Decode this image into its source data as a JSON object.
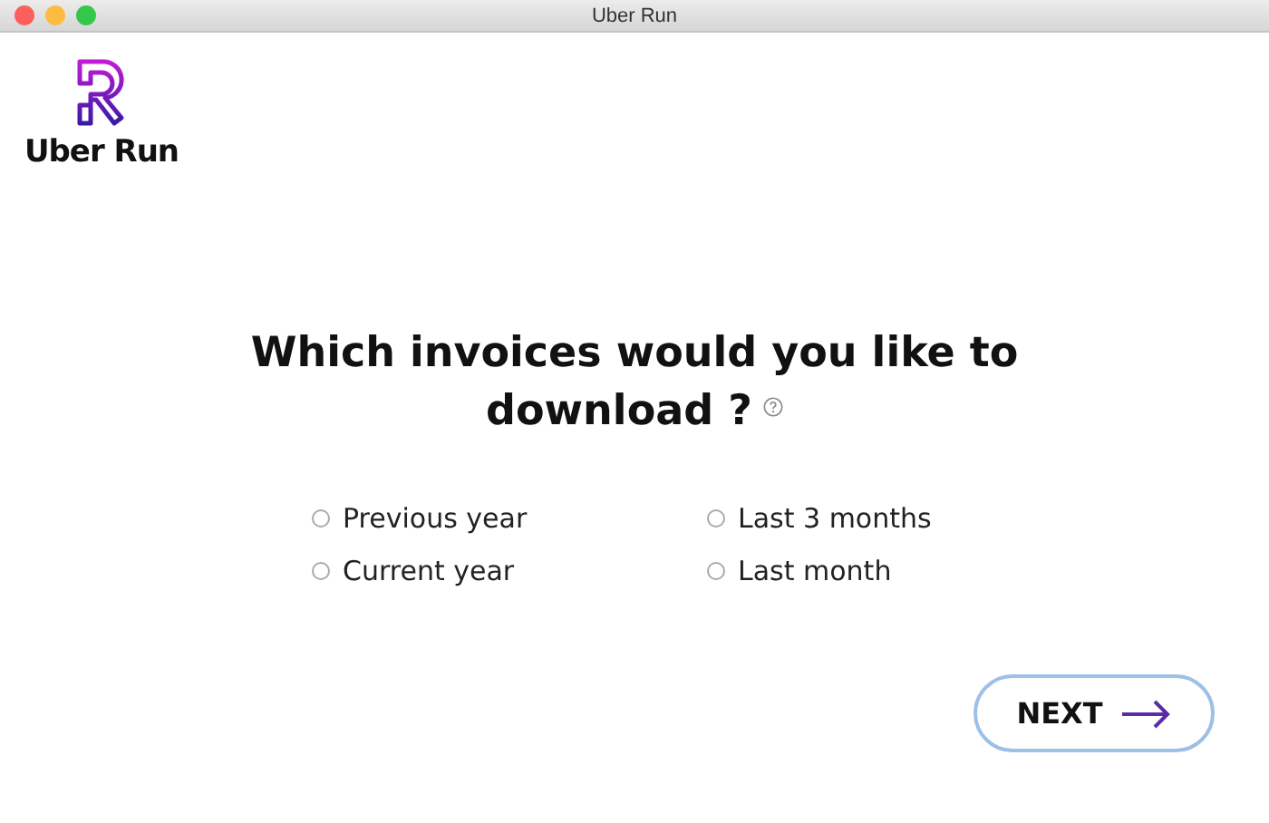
{
  "window": {
    "title": "Uber Run"
  },
  "app": {
    "name": "Uber Run"
  },
  "question": "Which invoices would you like to download ?",
  "options": [
    {
      "label": "Previous year",
      "selected": false
    },
    {
      "label": "Last 3 months",
      "selected": false
    },
    {
      "label": "Current year",
      "selected": false
    },
    {
      "label": "Last month",
      "selected": false
    }
  ],
  "next_button": {
    "label": "NEXT"
  }
}
